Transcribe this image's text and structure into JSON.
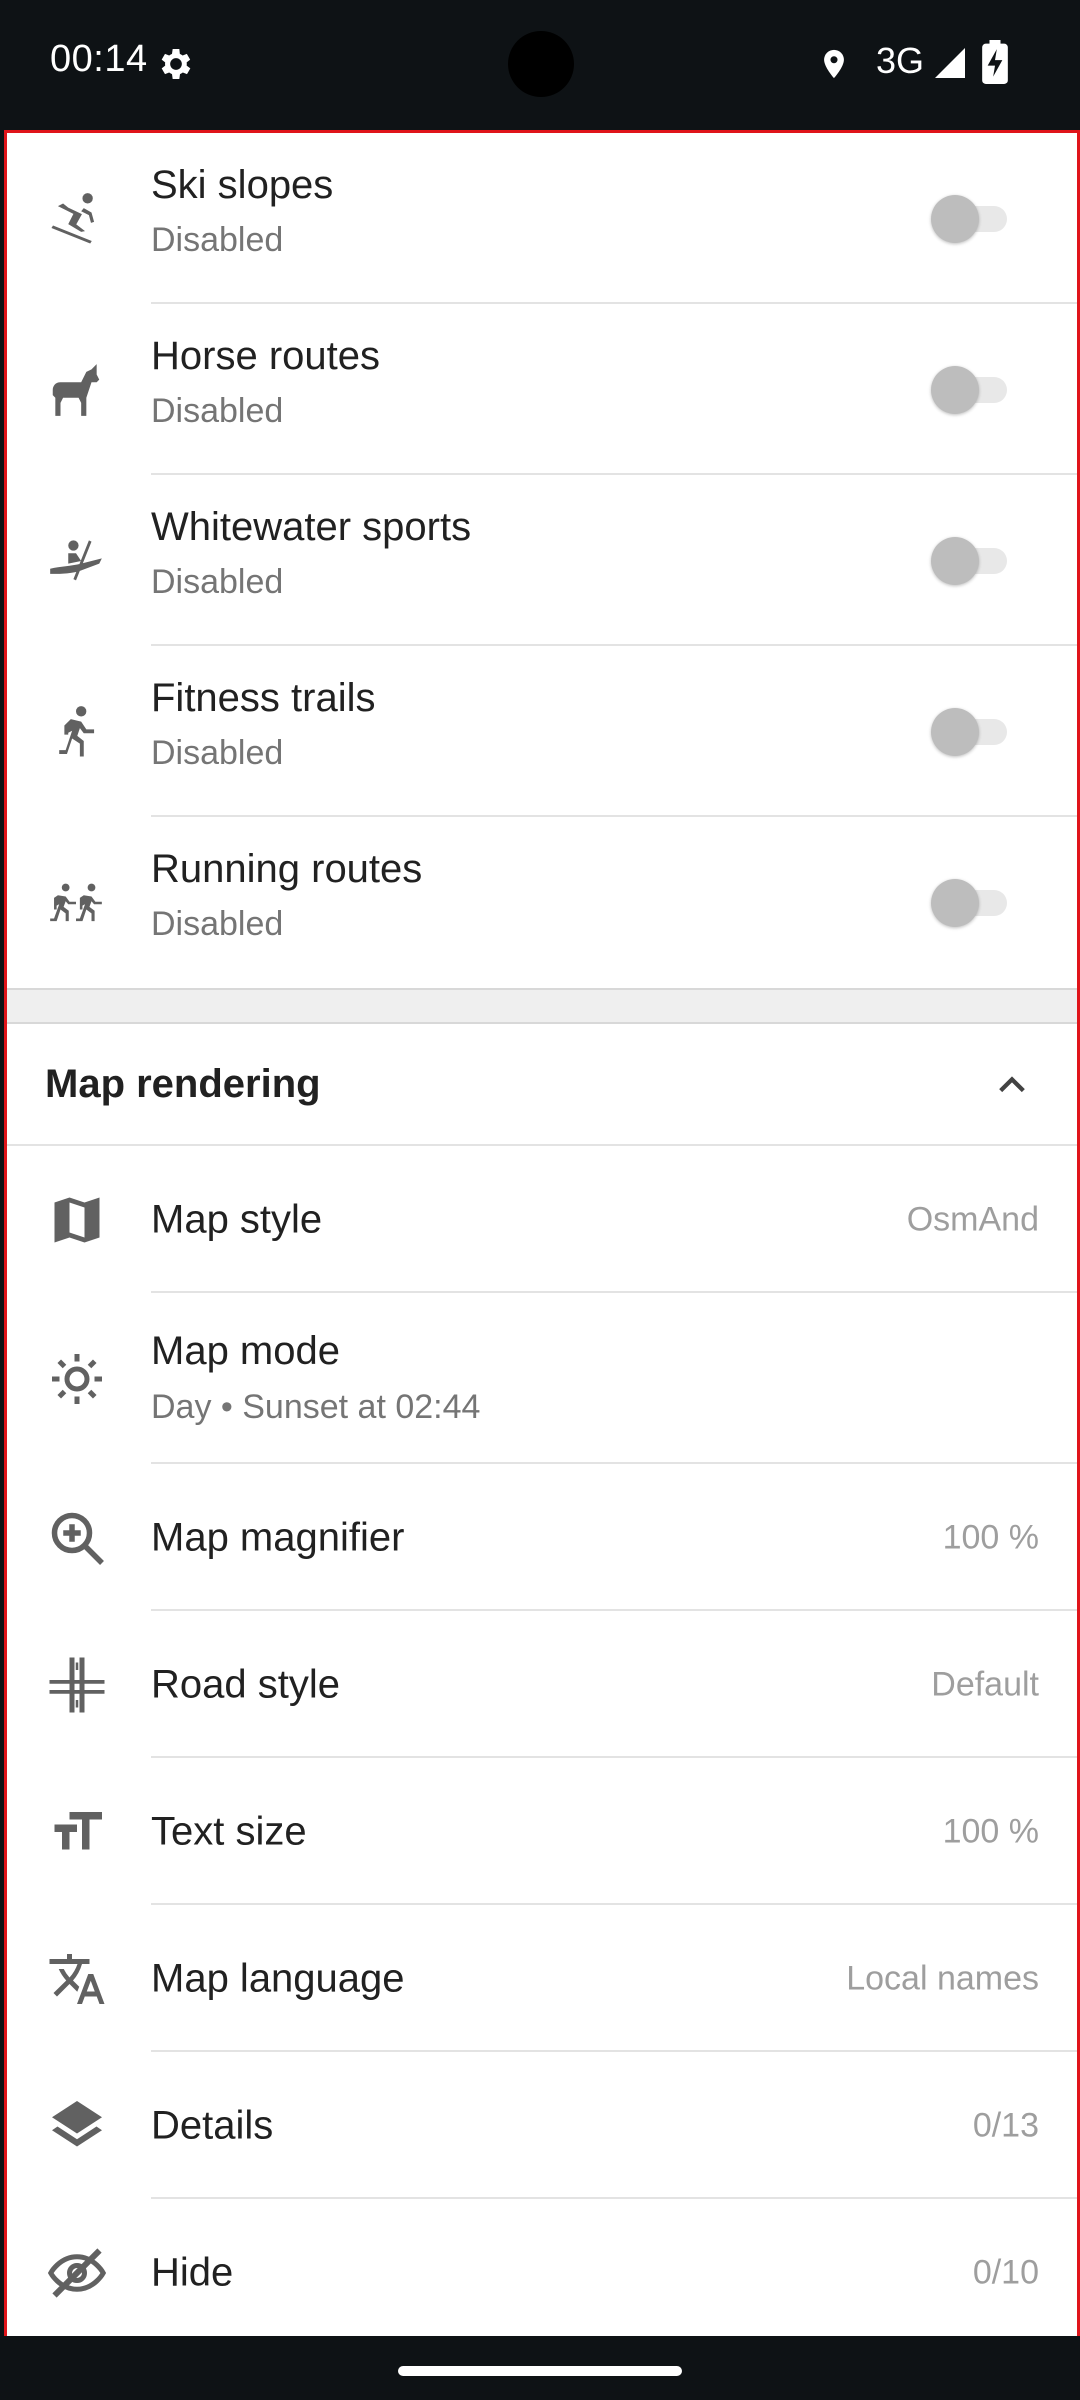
{
  "status_bar": {
    "time": "00:14",
    "network": "3G",
    "icons": [
      "settings-gear-icon",
      "location-icon",
      "signal-icon",
      "battery-charging-icon"
    ]
  },
  "routes": [
    {
      "title": "Ski slopes",
      "subtitle": "Disabled",
      "icon": "skier-icon",
      "enabled": false
    },
    {
      "title": "Horse routes",
      "subtitle": "Disabled",
      "icon": "horse-icon",
      "enabled": false
    },
    {
      "title": "Whitewater sports",
      "subtitle": "Disabled",
      "icon": "kayak-icon",
      "enabled": false
    },
    {
      "title": "Fitness trails",
      "subtitle": "Disabled",
      "icon": "runner-icon",
      "enabled": false
    },
    {
      "title": "Running routes",
      "subtitle": "Disabled",
      "icon": "runners-icon",
      "enabled": false
    }
  ],
  "map_rendering": {
    "header": "Map rendering",
    "items": [
      {
        "title": "Map style",
        "value": "OsmAnd",
        "icon": "map-icon"
      },
      {
        "title": "Map mode",
        "subtitle": "Day • Sunset at 02:44",
        "icon": "sun-icon"
      },
      {
        "title": "Map magnifier",
        "value": "100 %",
        "icon": "magnifier-icon"
      },
      {
        "title": "Road style",
        "value": "Default",
        "icon": "road-icon"
      },
      {
        "title": "Text size",
        "value": "100 %",
        "icon": "text-size-icon"
      },
      {
        "title": "Map language",
        "value": "Local names",
        "icon": "translate-icon"
      },
      {
        "title": "Details",
        "value": "0/13",
        "icon": "layers-icon"
      },
      {
        "title": "Hide",
        "value": "0/10",
        "icon": "eye-off-icon"
      }
    ]
  },
  "colors": {
    "accent_border": "#e0141a",
    "icon": "#616161",
    "toggle_off": "#bdbdbd"
  }
}
